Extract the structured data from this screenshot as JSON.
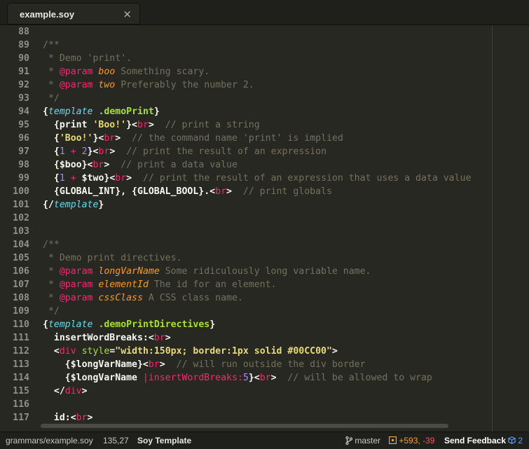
{
  "tab": {
    "title": "example.soy",
    "close_icon": "×"
  },
  "editor": {
    "lines": [
      {
        "num": "88"
      },
      {
        "num": "89",
        "tokens": [
          {
            "c": "c",
            "t": "/**"
          }
        ]
      },
      {
        "num": "90",
        "tokens": [
          {
            "c": "c",
            "t": " * Demo 'print'."
          }
        ]
      },
      {
        "num": "91",
        "tokens": [
          {
            "c": "c",
            "t": " * "
          },
          {
            "c": "k",
            "t": "@param"
          },
          {
            "c": "c",
            "t": " "
          },
          {
            "c": "v",
            "t": "boo"
          },
          {
            "c": "c",
            "t": " Something scary."
          }
        ]
      },
      {
        "num": "92",
        "tokens": [
          {
            "c": "c",
            "t": " * "
          },
          {
            "c": "k",
            "t": "@param"
          },
          {
            "c": "c",
            "t": " "
          },
          {
            "c": "v",
            "t": "two"
          },
          {
            "c": "c",
            "t": " Preferably the number 2."
          }
        ]
      },
      {
        "num": "93",
        "tokens": [
          {
            "c": "c",
            "t": " */"
          }
        ]
      },
      {
        "num": "94",
        "tokens": [
          {
            "c": "p",
            "t": "{"
          },
          {
            "c": "t",
            "t": "template"
          },
          {
            "c": "p",
            "t": " "
          },
          {
            "c": "f",
            "t": ".demoPrint"
          },
          {
            "c": "p",
            "t": "}"
          }
        ]
      },
      {
        "num": "95",
        "tokens": [
          {
            "c": "p",
            "t": "  {print "
          },
          {
            "c": "s",
            "t": "'Boo!'"
          },
          {
            "c": "p",
            "t": "}<"
          },
          {
            "c": "k",
            "t": "br"
          },
          {
            "c": "p",
            "t": ">  "
          },
          {
            "c": "c",
            "t": "// print a string"
          }
        ]
      },
      {
        "num": "96",
        "tokens": [
          {
            "c": "p",
            "t": "  {"
          },
          {
            "c": "s",
            "t": "'Boo!'"
          },
          {
            "c": "p",
            "t": "}<"
          },
          {
            "c": "k",
            "t": "br"
          },
          {
            "c": "p",
            "t": ">  "
          },
          {
            "c": "c",
            "t": "// the command name 'print' is implied"
          }
        ]
      },
      {
        "num": "97",
        "tokens": [
          {
            "c": "p",
            "t": "  {"
          },
          {
            "c": "n",
            "t": "1"
          },
          {
            "c": "p",
            "t": " "
          },
          {
            "c": "k",
            "t": "+"
          },
          {
            "c": "p",
            "t": " "
          },
          {
            "c": "n",
            "t": "2"
          },
          {
            "c": "p",
            "t": "}<"
          },
          {
            "c": "k",
            "t": "br"
          },
          {
            "c": "p",
            "t": ">  "
          },
          {
            "c": "c",
            "t": "// print the result of an expression"
          }
        ]
      },
      {
        "num": "98",
        "tokens": [
          {
            "c": "p",
            "t": "  {$boo}<"
          },
          {
            "c": "k",
            "t": "br"
          },
          {
            "c": "p",
            "t": ">  "
          },
          {
            "c": "c",
            "t": "// print a data value"
          }
        ]
      },
      {
        "num": "99",
        "tokens": [
          {
            "c": "p",
            "t": "  {"
          },
          {
            "c": "n",
            "t": "1"
          },
          {
            "c": "p",
            "t": " "
          },
          {
            "c": "k",
            "t": "+"
          },
          {
            "c": "p",
            "t": " $two}<"
          },
          {
            "c": "k",
            "t": "br"
          },
          {
            "c": "p",
            "t": ">  "
          },
          {
            "c": "c",
            "t": "// print the result of an expression that uses a data value"
          }
        ]
      },
      {
        "num": "100",
        "tokens": [
          {
            "c": "p",
            "t": "  {GLOBAL_INT}, {GLOBAL_BOOL}.<"
          },
          {
            "c": "k",
            "t": "br"
          },
          {
            "c": "p",
            "t": ">  "
          },
          {
            "c": "c",
            "t": "// print globals"
          }
        ]
      },
      {
        "num": "101",
        "tokens": [
          {
            "c": "p",
            "t": "{/"
          },
          {
            "c": "t",
            "t": "template"
          },
          {
            "c": "p",
            "t": "}"
          }
        ]
      },
      {
        "num": "102"
      },
      {
        "num": "103"
      },
      {
        "num": "104",
        "tokens": [
          {
            "c": "c",
            "t": "/**"
          }
        ]
      },
      {
        "num": "105",
        "tokens": [
          {
            "c": "c",
            "t": " * Demo print directives."
          }
        ]
      },
      {
        "num": "106",
        "tokens": [
          {
            "c": "c",
            "t": " * "
          },
          {
            "c": "k",
            "t": "@param"
          },
          {
            "c": "c",
            "t": " "
          },
          {
            "c": "v",
            "t": "longVarName"
          },
          {
            "c": "c",
            "t": " Some ridiculously long variable name."
          }
        ]
      },
      {
        "num": "107",
        "tokens": [
          {
            "c": "c",
            "t": " * "
          },
          {
            "c": "k",
            "t": "@param"
          },
          {
            "c": "c",
            "t": " "
          },
          {
            "c": "v",
            "t": "elementId"
          },
          {
            "c": "c",
            "t": " The id for an element."
          }
        ]
      },
      {
        "num": "108",
        "tokens": [
          {
            "c": "c",
            "t": " * "
          },
          {
            "c": "k",
            "t": "@param"
          },
          {
            "c": "c",
            "t": " "
          },
          {
            "c": "v",
            "t": "cssClass"
          },
          {
            "c": "c",
            "t": " A CSS class name."
          }
        ]
      },
      {
        "num": "109",
        "tokens": [
          {
            "c": "c",
            "t": " */"
          }
        ]
      },
      {
        "num": "110",
        "tokens": [
          {
            "c": "p",
            "t": "{"
          },
          {
            "c": "t",
            "t": "template"
          },
          {
            "c": "p",
            "t": " "
          },
          {
            "c": "f",
            "t": ".demoPrintDirectives"
          },
          {
            "c": "p",
            "t": "}"
          }
        ]
      },
      {
        "num": "111",
        "tokens": [
          {
            "c": "p",
            "t": "  insertWordBreaks:<"
          },
          {
            "c": "k",
            "t": "br"
          },
          {
            "c": "p",
            "t": ">"
          }
        ]
      },
      {
        "num": "112",
        "tokens": [
          {
            "c": "p",
            "t": "  <"
          },
          {
            "c": "k",
            "t": "div"
          },
          {
            "c": "p",
            "t": " "
          },
          {
            "c": "a",
            "t": "style"
          },
          {
            "c": "p",
            "t": "="
          },
          {
            "c": "s",
            "t": "\"width:150px; border:1px solid #00CC00\""
          },
          {
            "c": "p",
            "t": ">"
          }
        ]
      },
      {
        "num": "113",
        "tokens": [
          {
            "c": "p",
            "t": "    {$longVarName}<"
          },
          {
            "c": "k",
            "t": "br"
          },
          {
            "c": "p",
            "t": ">  "
          },
          {
            "c": "c",
            "t": "// will run outside the div border"
          }
        ]
      },
      {
        "num": "114",
        "tokens": [
          {
            "c": "p",
            "t": "    {$longVarName "
          },
          {
            "c": "k",
            "t": "|insertWordBreaks:"
          },
          {
            "c": "n",
            "t": "5"
          },
          {
            "c": "p",
            "t": "}<"
          },
          {
            "c": "k",
            "t": "br"
          },
          {
            "c": "p",
            "t": ">  "
          },
          {
            "c": "c",
            "t": "// will be allowed to wrap"
          }
        ]
      },
      {
        "num": "115",
        "tokens": [
          {
            "c": "p",
            "t": "  </"
          },
          {
            "c": "k",
            "t": "div"
          },
          {
            "c": "p",
            "t": ">"
          }
        ]
      },
      {
        "num": "116"
      },
      {
        "num": "117",
        "tokens": [
          {
            "c": "p",
            "t": "  id:<"
          },
          {
            "c": "k",
            "t": "br"
          },
          {
            "c": "p",
            "t": ">"
          }
        ]
      }
    ]
  },
  "status": {
    "path": "grammars/example.soy",
    "position": "135,27",
    "grammar": "Soy Template",
    "branch_icon": "git-branch-icon",
    "branch": "master",
    "diff_icon": "diff-icon",
    "additions": "+593,",
    "deletions": "-39",
    "feedback": "Send Feedback",
    "package_icon": "package-icon",
    "package_count": "2"
  },
  "colors": {
    "background": "#272822",
    "comment": "#75715e",
    "keyword": "#f92672",
    "string": "#e6db74",
    "number": "#ae81ff",
    "storage": "#66d9ef",
    "entity": "#a6e22e",
    "parameter": "#fd971f"
  }
}
